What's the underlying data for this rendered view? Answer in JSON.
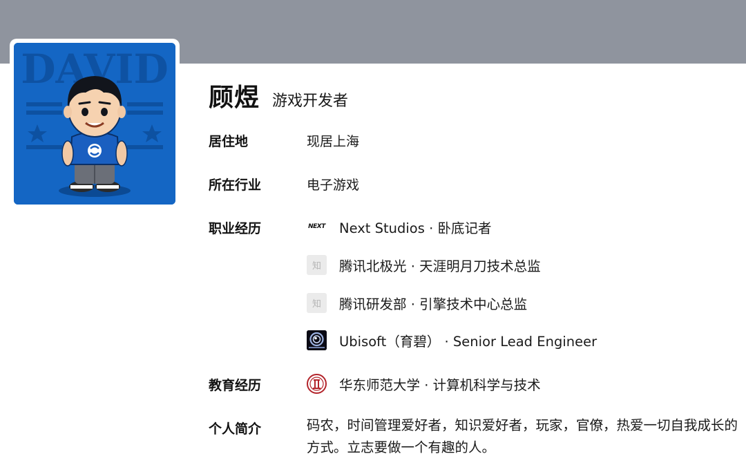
{
  "profile": {
    "name": "顾煜",
    "headline": "游戏开发者",
    "avatar_text": "DAVID"
  },
  "fields": {
    "residence_label": "居住地",
    "residence_value": "现居上海",
    "industry_label": "所在行业",
    "industry_value": "电子游戏",
    "career_label": "职业经历",
    "education_label": "教育经历",
    "bio_label": "个人简介"
  },
  "career": [
    {
      "text": "Next Studios · 卧底记者",
      "logo_text": "NEXT"
    },
    {
      "text": "腾讯北极光 · 天涯明月刀技术总监",
      "logo_text": "知"
    },
    {
      "text": "腾讯研发部 · 引擎技术中心总监",
      "logo_text": "知"
    },
    {
      "text": "Ubisoft（育碧） · Senior Lead Engineer",
      "logo_text": ""
    }
  ],
  "education": {
    "text": "华东师范大学 · 计算机科学与技术"
  },
  "bio": "码农，时间管理爱好者，知识爱好者，玩家，官僚，热爱一切自我成长的方式。立志要做一个有趣的人。",
  "colors": {
    "cover": "#8f949e",
    "avatar_bg": "#1466c4",
    "next_accent": "#e8731a"
  }
}
